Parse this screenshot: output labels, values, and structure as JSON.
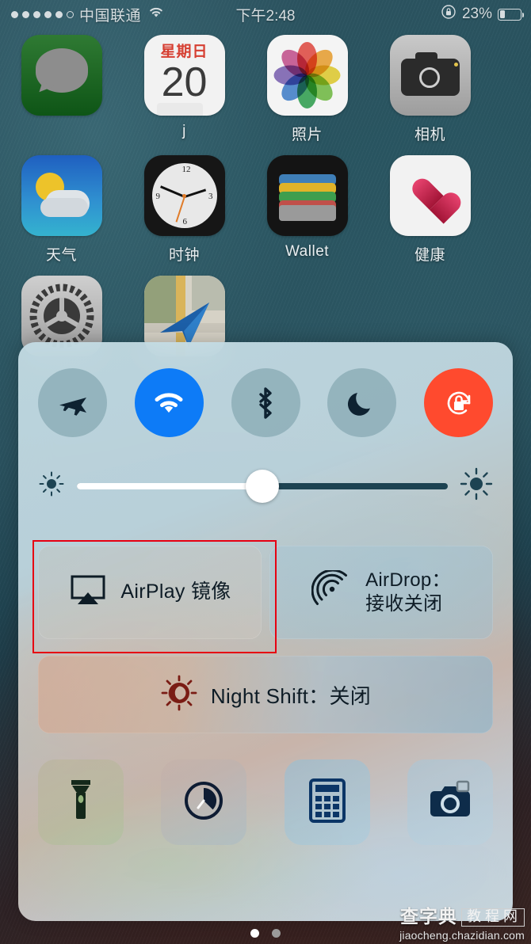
{
  "status_bar": {
    "signal_dots_filled": 5,
    "signal_dots_total": 6,
    "carrier": "中国联通",
    "wifi_icon": "wifi-icon",
    "time": "下午2:48",
    "rotation_lock_icon": "rotation-lock-icon",
    "battery_percent": "23%"
  },
  "home_screen": {
    "rows": [
      [
        {
          "name": "messages",
          "label": ""
        },
        {
          "name": "calendar",
          "label": "j",
          "weekday": "星期日",
          "day": "20"
        },
        {
          "name": "photos",
          "label": "照片"
        },
        {
          "name": "camera",
          "label": "相机"
        }
      ],
      [
        {
          "name": "weather",
          "label": "天气"
        },
        {
          "name": "clock",
          "label": "时钟"
        },
        {
          "name": "wallet",
          "label": "Wallet"
        },
        {
          "name": "health",
          "label": "健康"
        }
      ],
      [
        {
          "name": "settings",
          "label": ""
        },
        {
          "name": "maps",
          "label": ""
        }
      ]
    ]
  },
  "control_center": {
    "toggles": [
      {
        "name": "airplane-mode",
        "icon": "airplane-icon",
        "state": "off"
      },
      {
        "name": "wifi",
        "icon": "wifi-icon",
        "state": "on",
        "color": "#0d7bf7"
      },
      {
        "name": "bluetooth",
        "icon": "bluetooth-icon",
        "state": "off"
      },
      {
        "name": "do-not-disturb",
        "icon": "moon-icon",
        "state": "off"
      },
      {
        "name": "rotation-lock",
        "icon": "rotation-lock-icon",
        "state": "on",
        "color": "#ff4a2e"
      }
    ],
    "brightness": {
      "name": "brightness-slider",
      "value_percent": 50,
      "low_icon": "sun-small-icon",
      "high_icon": "sun-large-icon"
    },
    "airplay": {
      "icon": "airplay-icon",
      "label": "AirPlay 镜像"
    },
    "airdrop": {
      "icon": "airdrop-icon",
      "label_line1": "AirDrop：",
      "label_line2": "接收关闭"
    },
    "night_shift": {
      "icon": "night-shift-icon",
      "label": "Night Shift：关闭"
    },
    "shortcuts": [
      {
        "name": "flashlight",
        "icon": "flashlight-icon"
      },
      {
        "name": "timer",
        "icon": "timer-icon"
      },
      {
        "name": "calculator",
        "icon": "calculator-icon"
      },
      {
        "name": "camera",
        "icon": "camera-icon"
      }
    ]
  },
  "annotation": {
    "name": "airplay-highlight-box",
    "color": "#e60012"
  },
  "page_dots": {
    "total": 2,
    "active_index": 0
  },
  "watermark": {
    "brand": "查字典",
    "section": "教程网",
    "url": "jiaocheng.chazidian.com"
  }
}
